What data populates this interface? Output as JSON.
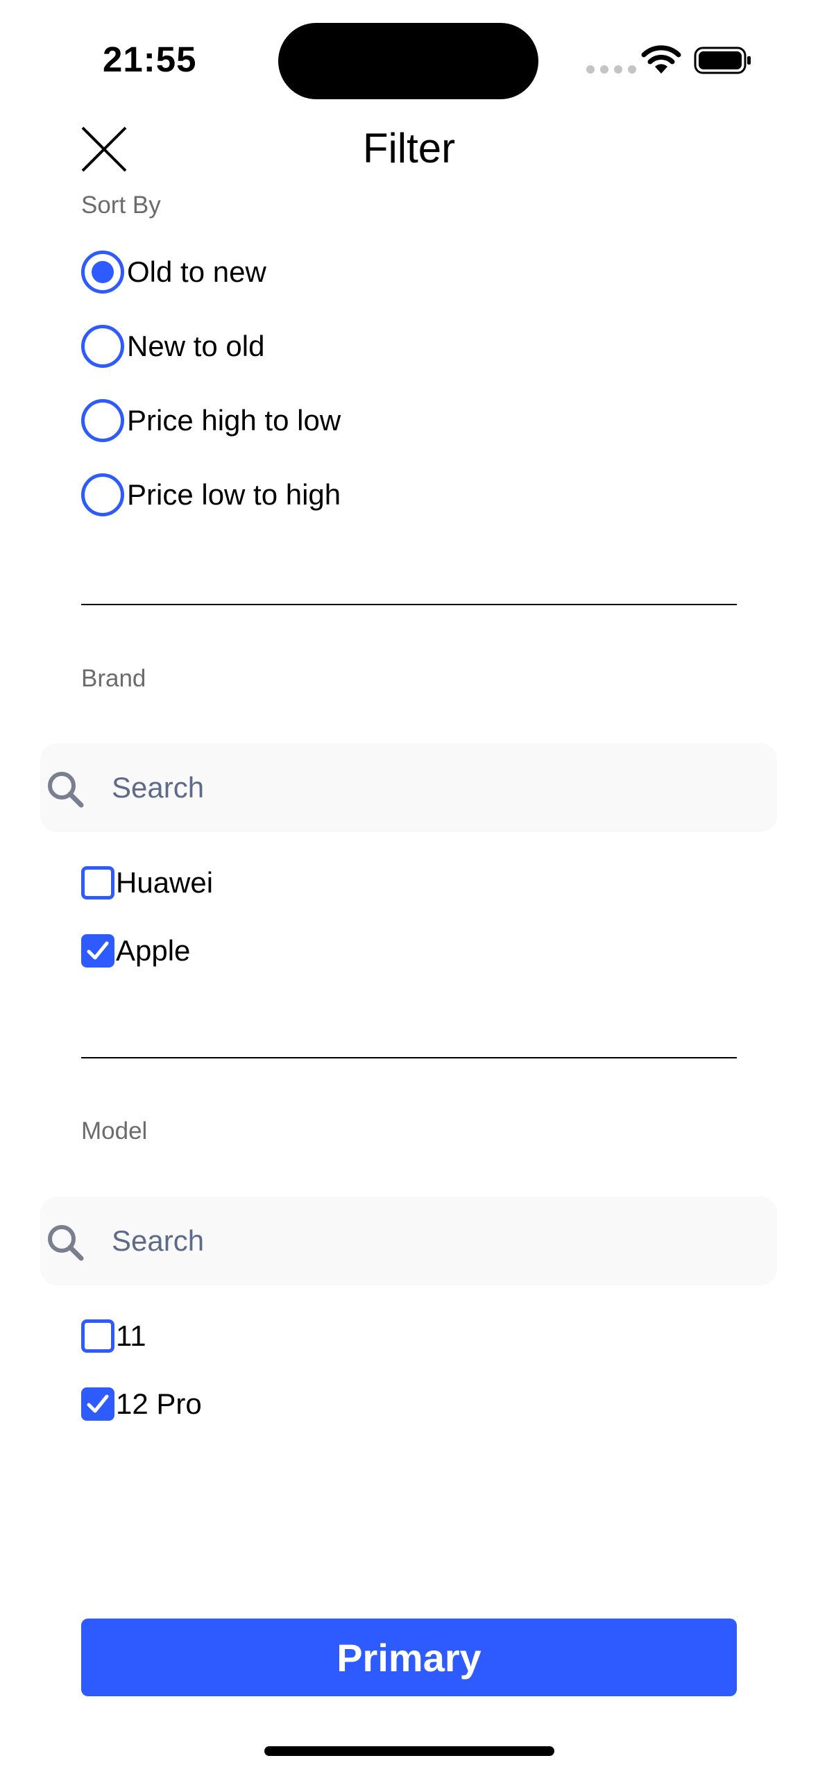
{
  "status_bar": {
    "time": "21:55"
  },
  "header": {
    "title": "Filter"
  },
  "sort_by": {
    "label": "Sort By",
    "options": [
      {
        "label": "Old to new",
        "selected": true
      },
      {
        "label": "New to old",
        "selected": false
      },
      {
        "label": "Price high to low",
        "selected": false
      },
      {
        "label": "Price low to high",
        "selected": false
      }
    ]
  },
  "brand": {
    "label": "Brand",
    "search_placeholder": "Search",
    "items": [
      {
        "label": "Huawei",
        "checked": false
      },
      {
        "label": "Apple",
        "checked": true
      }
    ]
  },
  "model": {
    "label": "Model",
    "search_placeholder": "Search",
    "items": [
      {
        "label": "11",
        "checked": false
      },
      {
        "label": "12 Pro",
        "checked": true
      }
    ]
  },
  "primary_button": {
    "label": "Primary"
  },
  "colors": {
    "accent": "#2E5BFF",
    "search_bg": "#F9F9F9",
    "label_gray": "#6B6B6B"
  }
}
